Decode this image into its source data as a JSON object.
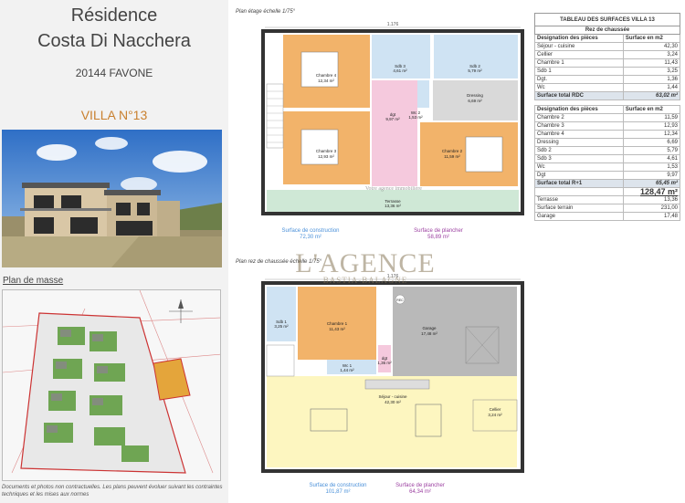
{
  "header": {
    "title_line1": "Résidence",
    "title_line2": "Costa Di Nacchera",
    "city": "20144 FAVONE",
    "villa": "VILLA N°13"
  },
  "site_plan": {
    "label": "Plan de masse"
  },
  "disclaimer": "Documents et photos non contractuelles. Les plans peuvent évoluer suivant les contraintes techniques et les mises aux normes",
  "upper_plan": {
    "label": "Plan étage échelle 1/75°",
    "dimension_top": "1.176",
    "surface_construction_label": "Surface de construction",
    "surface_construction_value": "72,30 m²",
    "surface_plancher_label": "Surface de plancher",
    "surface_plancher_value": "58,89 m²",
    "rooms": [
      {
        "name": "Chambre 4",
        "area": "12,34 m²"
      },
      {
        "name": "Sdb 3",
        "area": "4,61 m²"
      },
      {
        "name": "Sdb 2",
        "area": "5,79 m²"
      },
      {
        "name": "Wc 2",
        "area": "1,53 m²"
      },
      {
        "name": "Dressing",
        "area": "6,69 m²"
      },
      {
        "name": "dgt",
        "area": "9,97 m²"
      },
      {
        "name": "Chambre 3",
        "area": "12,93 m²"
      },
      {
        "name": "Chambre 2",
        "area": "11,59 m²"
      },
      {
        "name": "Terrasse",
        "area": "13,36 m²"
      }
    ],
    "agency_banner": "Votre agence immobilière"
  },
  "ground_plan": {
    "label": "Plan rez de chaussée échelle 1/75°",
    "dimension_top": "1.176",
    "rooms": [
      {
        "name": "Sdb 1",
        "area": "3,25 m²"
      },
      {
        "name": "Chambre 1",
        "area": "11,43 m²"
      },
      {
        "name": "Garage",
        "area": "17,48 m²"
      },
      {
        "name": "dgt",
        "area": "1,36 m²"
      },
      {
        "name": "Wc 1",
        "area": "1,44 m²"
      },
      {
        "name": "Séjour - cuisine",
        "area": "42,30 m²"
      },
      {
        "name": "Cellier",
        "area": "3,24 m²"
      }
    ],
    "rec_label": "REC",
    "surface_construction_label": "Surface de construction",
    "surface_construction_value": "101,87 m²",
    "surface_plancher_label": "Surface de plancher",
    "surface_plancher_value": "64,34 m²"
  },
  "watermark": {
    "big": "L'AGENCE",
    "small": "BASTIA-BALAGNE"
  },
  "table": {
    "title": "TABLEAU DES SURFACES VILLA 13",
    "rdc_header": "Rez de chaussée",
    "col_piece": "Designation des pièces",
    "col_surface": "Surface en m2",
    "rdc_rows": [
      {
        "name": "Séjour - cuisine",
        "value": "42,30"
      },
      {
        "name": "Cellier",
        "value": "3,24"
      },
      {
        "name": "Chambre 1",
        "value": "11,43"
      },
      {
        "name": "Sdb 1",
        "value": "3,25"
      },
      {
        "name": "Dgt.",
        "value": "1,36"
      },
      {
        "name": "Wc",
        "value": "1,44"
      }
    ],
    "rdc_total_label": "Surface total RDC",
    "rdc_total_value": "63,02 m²",
    "r1_rows": [
      {
        "name": "Chambre 2",
        "value": "11,59"
      },
      {
        "name": "Chambre 3",
        "value": "12,93"
      },
      {
        "name": "Chambre 4",
        "value": "12,34"
      },
      {
        "name": "Dressing",
        "value": "6,69"
      },
      {
        "name": "Sdb 2",
        "value": "5,79"
      },
      {
        "name": "Sdb 3",
        "value": "4,61"
      },
      {
        "name": "Wc",
        "value": "1,53"
      },
      {
        "name": "Dgt",
        "value": "9,97"
      }
    ],
    "r1_total_label": "Surface total R+1",
    "r1_total_value": "65,45 m²",
    "grand_total": "128,47 m²",
    "extra_rows": [
      {
        "name": "Terrasse",
        "value": "13,36"
      },
      {
        "name": "Surface terrain",
        "value": "231,00"
      },
      {
        "name": "Garage",
        "value": "17,48"
      }
    ]
  },
  "colors": {
    "bedroom": "#f2b36a",
    "bathroom": "#cfe3f3",
    "hall": "#f5c9dd",
    "living": "#fdf6c0",
    "garage": "#b9b9b9",
    "terrace": "#cfe8d6",
    "accent": "#c9802f"
  }
}
